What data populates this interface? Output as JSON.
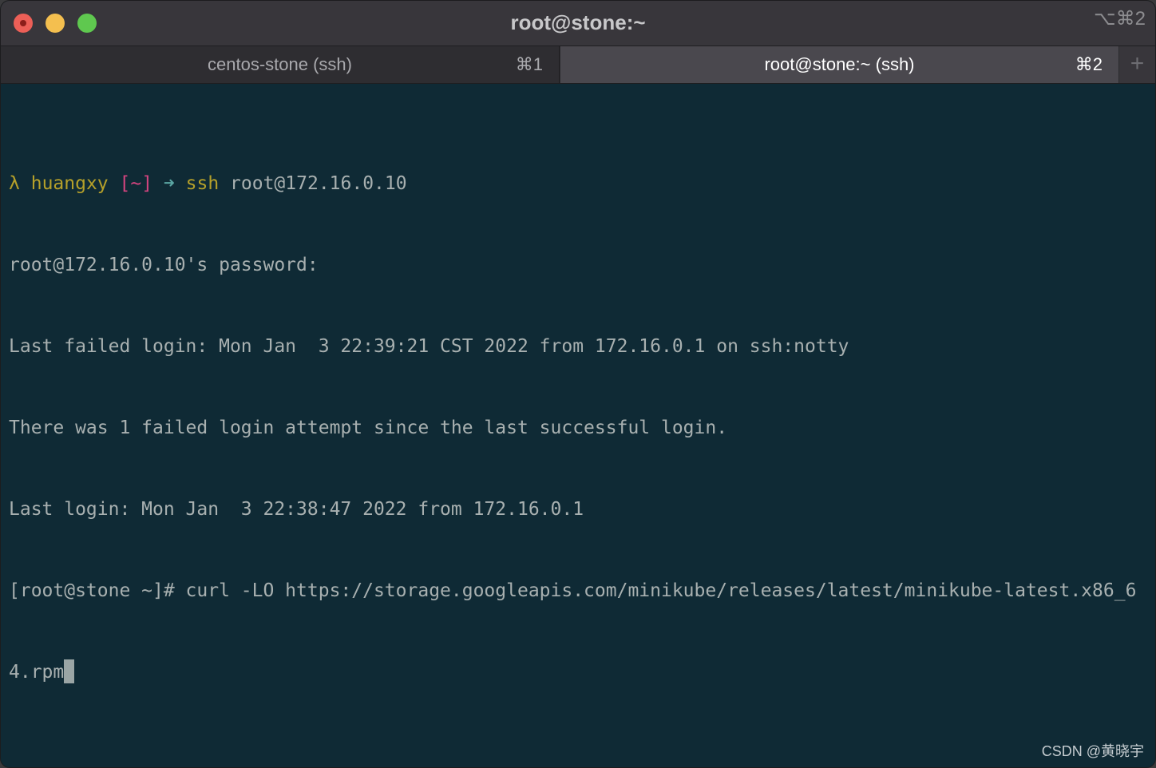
{
  "window": {
    "title": "root@stone:~",
    "shortcut": "⌥⌘2"
  },
  "tabs": [
    {
      "label": "centos-stone (ssh)",
      "shortcut": "⌘1",
      "active": false
    },
    {
      "label": "root@stone:~ (ssh)",
      "shortcut": "⌘2",
      "active": true
    }
  ],
  "new_tab": {
    "symbol": "+"
  },
  "terminal": {
    "prompt": {
      "lambda": "λ",
      "user": "huangxy",
      "dir": "[~]",
      "arrow": "➜",
      "cmd": "ssh",
      "args": "root@172.16.0.10"
    },
    "lines": [
      "root@172.16.0.10's password:",
      "Last failed login: Mon Jan  3 22:39:21 CST 2022 from 172.16.0.1 on ssh:notty",
      "There was 1 failed login attempt since the last successful login.",
      "Last login: Mon Jan  3 22:38:47 2022 from 172.16.0.1",
      "[root@stone ~]# curl -LO https://storage.googleapis.com/minikube/releases/latest/minikube-latest.x86_6",
      "4.rpm"
    ]
  },
  "watermark": "CSDN @黄晓宇",
  "colors": {
    "terminal_bg": "#0f2a35",
    "text": "#a8b0b0",
    "prompt_yellow": "#b5a02a",
    "prompt_pink": "#d3447f",
    "prompt_cyan": "#5aa6a3"
  }
}
